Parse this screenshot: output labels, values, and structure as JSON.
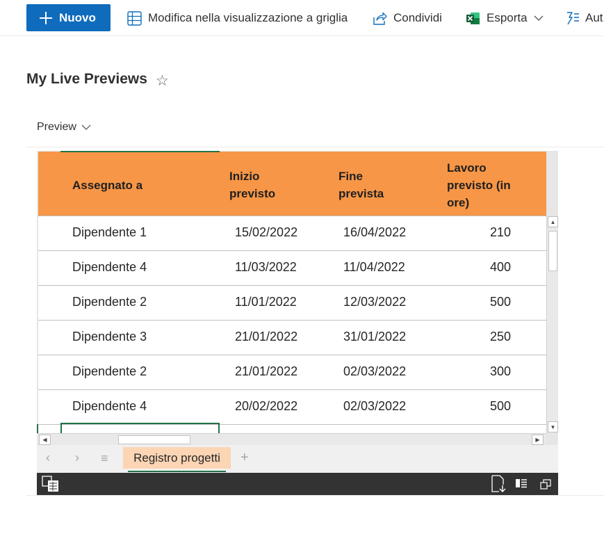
{
  "command_bar": {
    "new_label": "Nuovo",
    "grid_edit_label": "Modifica nella visualizzazione a griglia",
    "share_label": "Condividi",
    "export_label": "Esporta",
    "automate_label": "Aut"
  },
  "page": {
    "title": "My Live Previews",
    "star": "☆",
    "view_label": "Preview"
  },
  "workbook": {
    "columns": [
      "Assegnato a",
      "Inizio\nprevisto",
      "Fine\nprevista",
      "Lavoro\nprevisto (in\nore)"
    ],
    "rows": [
      {
        "assignee": "Dipendente 1",
        "start": "15/02/2022",
        "end": "16/04/2022",
        "hours": "210"
      },
      {
        "assignee": "Dipendente 4",
        "start": "11/03/2022",
        "end": "11/04/2022",
        "hours": "400"
      },
      {
        "assignee": "Dipendente 2",
        "start": "11/01/2022",
        "end": "12/03/2022",
        "hours": "500"
      },
      {
        "assignee": "Dipendente 3",
        "start": "21/01/2022",
        "end": "31/01/2022",
        "hours": "250"
      },
      {
        "assignee": "Dipendente 2",
        "start": "21/01/2022",
        "end": "02/03/2022",
        "hours": "300"
      },
      {
        "assignee": "Dipendente 4",
        "start": "20/02/2022",
        "end": "02/03/2022",
        "hours": "500"
      }
    ],
    "sheet_tab": "Registro progetti",
    "colors": {
      "header": "#f79646",
      "tab": "#fcd5b4",
      "selection": "#217346"
    }
  },
  "icons": {
    "new": "plus-icon",
    "grid": "grid-icon",
    "share": "share-icon",
    "export": "excel-icon",
    "automate": "flow-icon"
  },
  "colors": {
    "primary": "#0f6cbd",
    "text": "#323130"
  }
}
